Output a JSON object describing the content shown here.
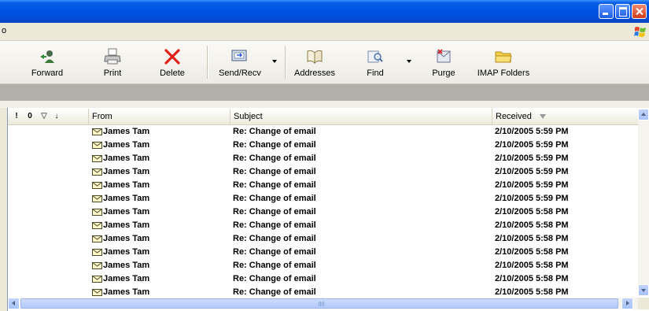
{
  "menubar": {
    "fragment": "o"
  },
  "toolbar": {
    "buttons": [
      {
        "label": "Forward",
        "icon": "forward-icon"
      },
      {
        "label": "Print",
        "icon": "printer-icon"
      },
      {
        "label": "Delete",
        "icon": "delete-x-icon"
      },
      {
        "label": "Send/Recv",
        "icon": "send-receive-icon"
      },
      {
        "label": "Addresses",
        "icon": "address-book-icon"
      },
      {
        "label": "Find",
        "icon": "find-icon"
      },
      {
        "label": "Purge",
        "icon": "purge-icon"
      },
      {
        "label": "IMAP Folders",
        "icon": "folder-icon"
      }
    ]
  },
  "list": {
    "columns": {
      "importance": "!",
      "attachment": "0",
      "flag": "▽",
      "priority": "↓",
      "from": "From",
      "subject": "Subject",
      "received": "Received"
    },
    "sort_column": "Received",
    "rows": [
      {
        "from": "James Tam",
        "subject": "Re: Change of email",
        "received": "2/10/2005 5:59 PM"
      },
      {
        "from": "James Tam",
        "subject": "Re: Change of email",
        "received": "2/10/2005 5:59 PM"
      },
      {
        "from": "James Tam",
        "subject": "Re: Change of email",
        "received": "2/10/2005 5:59 PM"
      },
      {
        "from": "James Tam",
        "subject": "Re: Change of email",
        "received": "2/10/2005 5:59 PM"
      },
      {
        "from": "James Tam",
        "subject": "Re: Change of email",
        "received": "2/10/2005 5:59 PM"
      },
      {
        "from": "James Tam",
        "subject": "Re: Change of email",
        "received": "2/10/2005 5:59 PM"
      },
      {
        "from": "James Tam",
        "subject": "Re: Change of email",
        "received": "2/10/2005 5:58 PM"
      },
      {
        "from": "James Tam",
        "subject": "Re: Change of email",
        "received": "2/10/2005 5:58 PM"
      },
      {
        "from": "James Tam",
        "subject": "Re: Change of email",
        "received": "2/10/2005 5:58 PM"
      },
      {
        "from": "James Tam",
        "subject": "Re: Change of email",
        "received": "2/10/2005 5:58 PM"
      },
      {
        "from": "James Tam",
        "subject": "Re: Change of email",
        "received": "2/10/2005 5:58 PM"
      },
      {
        "from": "James Tam",
        "subject": "Re: Change of email",
        "received": "2/10/2005 5:58 PM"
      },
      {
        "from": "James Tam",
        "subject": "Re: Change of email",
        "received": "2/10/2005 5:58 PM"
      }
    ]
  },
  "colors": {
    "titlebar": "#0054e3",
    "toolbar_bg": "#ecebe4",
    "strip": "#b2b0a8",
    "delete_red": "#e0201b"
  }
}
